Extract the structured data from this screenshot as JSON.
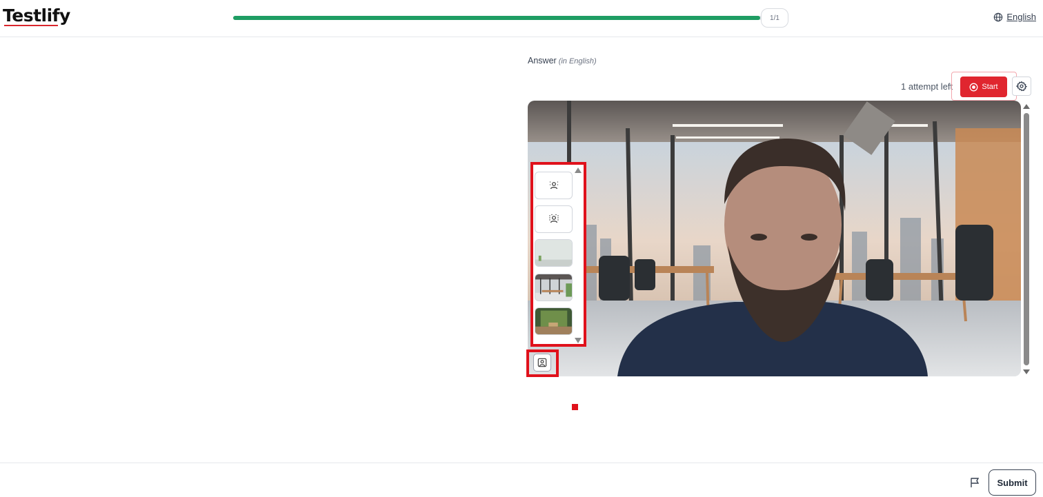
{
  "header": {
    "logo_text": "Testlify",
    "progress_label": "1/1",
    "progress_fraction": 0.98,
    "language_label": "English",
    "language_icon": "globe-icon"
  },
  "answer": {
    "label": "Answer",
    "sublabel": "(in English)",
    "attempts_text": "1 attempt left",
    "start_label": "Start",
    "start_icon": "record-icon",
    "settings_icon": "gear-icon"
  },
  "video": {
    "description_icon": "webcam-preview"
  },
  "background_picker": {
    "options": [
      {
        "icon": "person-blur-light-icon"
      },
      {
        "icon": "person-blur-strong-icon"
      },
      {
        "icon": "plain-room-thumbnail"
      },
      {
        "icon": "office-thumbnail"
      },
      {
        "icon": "green-wall-thumbnail"
      }
    ],
    "toggle_icon": "background-settings-icon"
  },
  "footer": {
    "flag_icon": "flag-icon",
    "submit_label": "Submit"
  },
  "colors": {
    "accent_red": "#e0262f",
    "progress_green": "#1f9d63",
    "highlight_red": "#e0111b"
  }
}
